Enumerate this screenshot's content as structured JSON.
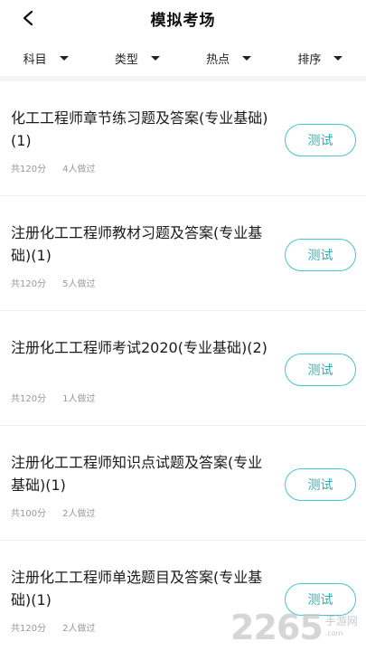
{
  "header": {
    "title": "模拟考场",
    "back_icon": "chevron-left-icon"
  },
  "filters": [
    {
      "label": "科目"
    },
    {
      "label": "类型"
    },
    {
      "label": "热点"
    },
    {
      "label": "排序"
    }
  ],
  "list": {
    "items": [
      {
        "title": "化工工程师章节练习题及答案(专业基础)(1)",
        "score": "共120分",
        "takers": "4人做过",
        "button": "测试"
      },
      {
        "title": "注册化工工程师教材习题及答案(专业基础)(1)",
        "score": "共120分",
        "takers": "5人做过",
        "button": "测试"
      },
      {
        "title": "注册化工工程师考试2020(专业基础)(2)",
        "score": "共120分",
        "takers": "1人做过",
        "button": "测试"
      },
      {
        "title": "注册化工工程师知识点试题及答案(专业基础)(1)",
        "score": "共100分",
        "takers": "2人做过",
        "button": "测试"
      },
      {
        "title": "注册化工工程师单选题目及答案(专业基础)(1)",
        "score": "共120分",
        "takers": "2人做过",
        "button": "测试"
      }
    ]
  },
  "watermark": {
    "number": "2265",
    "suffix": "手游网",
    "domain": ".com"
  },
  "colors": {
    "accent": "#2bb0bb",
    "accent_border": "#47c4cc",
    "meta_text": "#999999",
    "separator": "#f3f4f6"
  }
}
